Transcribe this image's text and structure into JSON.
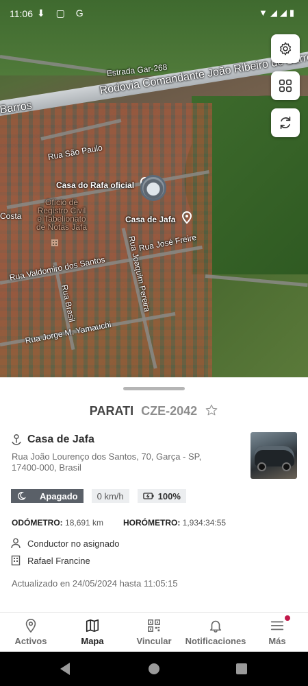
{
  "status_bar": {
    "time": "11:06",
    "left_icons": "⬇ ▢ G",
    "right_icons": "▼◢◢▮"
  },
  "map": {
    "labels": {
      "road1": "Estrada Gar-268",
      "road2": "Rodovia Comandante João Ribeiro de Barros",
      "barros": "Barros",
      "sao_paulo": "Rua São Paulo",
      "costa": "Costa",
      "oficio": "Ofício de Registro Civil e Tabelionato de Notas Jafa",
      "jose_freire": "Rua José Freire",
      "joaquim": "Rua Joaquim Pereira",
      "valdomiro": "Rua Valdomiro dos Santos",
      "brasil": "Rua Brasil",
      "yamauchi": "Rua Jorge M. Yamauchi"
    },
    "pins": {
      "rafa": "Casa do Rafa oficial",
      "jafa": "Casa de Jafa"
    }
  },
  "fabs": {
    "settings": "gear-icon",
    "grid": "grid-icon",
    "refresh": "refresh-icon"
  },
  "vehicle": {
    "model": "PARATI",
    "plate": "CZE-2042",
    "place": "Casa de Jafa",
    "address": "Rua João Lourenço dos Santos, 70, Garça - SP, 17400-000, Brasil",
    "status": "Apagado",
    "speed": "0 km/h",
    "battery": "100%",
    "odometer_label": "ODÓMETRO:",
    "odometer_value": "18,691 km",
    "hourmeter_label": "HORÓMETRO:",
    "hourmeter_value": "1,934:34:55",
    "driver": "Conductor no asignado",
    "company": "Rafael Francine",
    "updated": "Actualizado en 24/05/2024 hasta 11:05:15"
  },
  "nav": {
    "items": [
      {
        "label": "Activos",
        "icon": "pin-icon"
      },
      {
        "label": "Mapa",
        "icon": "map-icon"
      },
      {
        "label": "Vincular",
        "icon": "qr-icon"
      },
      {
        "label": "Notificaciones",
        "icon": "bell-icon"
      },
      {
        "label": "Más",
        "icon": "menu-icon"
      }
    ],
    "active": "Mapa"
  },
  "colors": {
    "accent": "#c2184a",
    "chip_dark": "#5a6068"
  }
}
